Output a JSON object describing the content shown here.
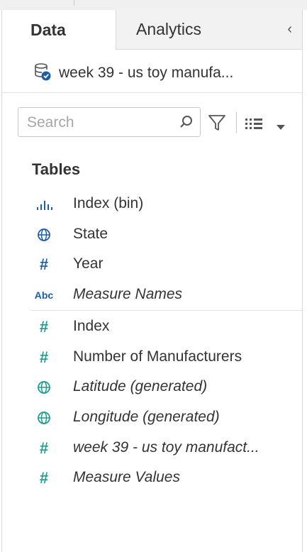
{
  "tabs": {
    "data_label": "Data",
    "analytics_label": "Analytics",
    "collapse_glyph": "‹"
  },
  "datasource": {
    "icon": "datasource-icon",
    "label": "week 39 - us toy manufa..."
  },
  "search": {
    "placeholder": "Search"
  },
  "tables_heading": "Tables",
  "dimensions": [
    {
      "label": "Index (bin)",
      "icon": "bin-bars-icon",
      "italic": false
    },
    {
      "label": "State",
      "icon": "globe-icon",
      "italic": false
    },
    {
      "label": "Year",
      "icon": "hash-icon",
      "italic": false
    },
    {
      "label": "Measure Names",
      "icon": "abc-icon",
      "icon_text": "Abc",
      "italic": true
    }
  ],
  "measures": [
    {
      "label": "Index",
      "icon": "hash-icon",
      "italic": false
    },
    {
      "label": "Number of Manufacturers",
      "icon": "hash-icon",
      "italic": false
    },
    {
      "label": "Latitude (generated)",
      "icon": "globe-icon",
      "italic": true
    },
    {
      "label": "Longitude (generated)",
      "icon": "globe-icon",
      "italic": true
    },
    {
      "label": "week 39 - us toy manufact...",
      "icon": "hash-icon",
      "italic": true
    },
    {
      "label": "Measure Values",
      "icon": "hash-icon",
      "italic": true
    }
  ],
  "colors": {
    "dimension_blue": "#1e5ea8",
    "measure_green": "#1a9f8f"
  }
}
